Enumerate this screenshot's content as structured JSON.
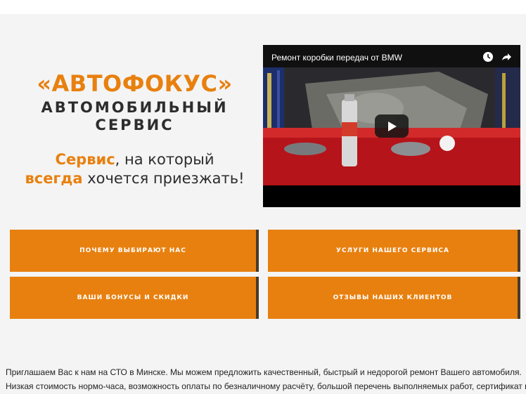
{
  "brand": {
    "title": "«АВТОФОКУС»",
    "subtitle_line1": "АВТОМОБИЛЬНЫЙ",
    "subtitle_line2": "СЕРВИС"
  },
  "slogan": {
    "part1_highlight": "Сервис",
    "part1_rest": ", на который",
    "part2_highlight": "всегда",
    "part2_rest": " хочется приезжать!"
  },
  "video": {
    "title": "Ремонт коробки передач от BMW",
    "icons": [
      "clock-icon",
      "share-icon",
      "play-icon"
    ]
  },
  "nav_buttons": [
    {
      "label": "ПОЧЕМУ ВЫБИРАЮТ НАС"
    },
    {
      "label": "УСЛУГИ НАШЕГО СЕРВИСА"
    },
    {
      "label": "ВАШИ БОНУСЫ И СКИДКИ"
    },
    {
      "label": "ОТЗЫВЫ НАШИХ КЛИЕНТОВ"
    }
  ],
  "intro": {
    "line1": "Приглашаем Вас к нам на СТО в Минске. Мы можем предложить качественный, быстрый и недорогой ремонт Вашего автомобиля.",
    "line2": "Низкая стоимость нормо-часа, возможность оплаты по безналичному расчёту, большой перечень выполняемых работ, сертификат на"
  },
  "colors": {
    "accent": "#e8800f",
    "text_dark": "#2d2d2d",
    "background": "#f4f4f4"
  }
}
